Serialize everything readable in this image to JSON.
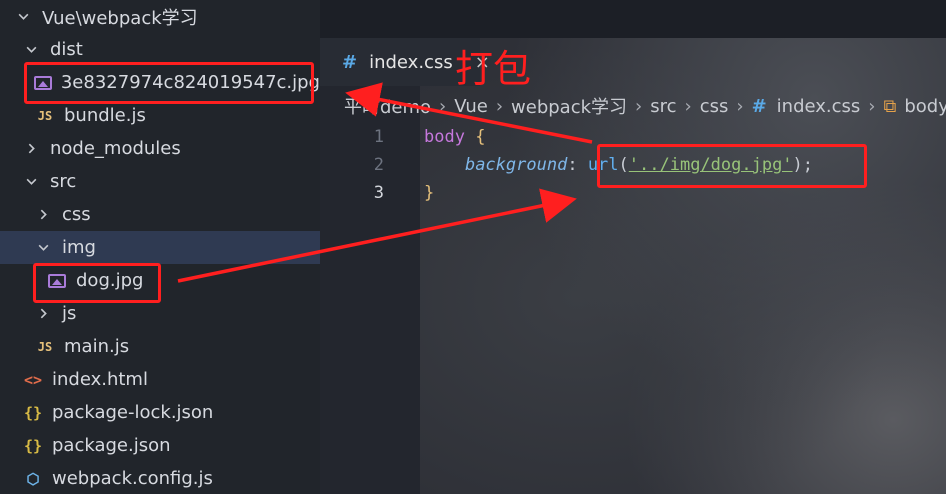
{
  "explorer": {
    "items": [
      {
        "label": "Vue\\webpack学习",
        "type": "folder-open",
        "icon": "chevron-down-icon"
      },
      {
        "label": "dist",
        "type": "folder-open",
        "icon": "chevron-down-icon"
      },
      {
        "label": "3e8327974c824019547c.jpg",
        "type": "image",
        "icon": "image-file-icon"
      },
      {
        "label": "bundle.js",
        "type": "js",
        "icon": "js-file-icon",
        "icon_text": "JS"
      },
      {
        "label": "node_modules",
        "type": "folder-closed",
        "icon": "chevron-right-icon"
      },
      {
        "label": "src",
        "type": "folder-open",
        "icon": "chevron-down-icon"
      },
      {
        "label": "css",
        "type": "folder-closed",
        "icon": "chevron-right-icon"
      },
      {
        "label": "img",
        "type": "folder-open",
        "icon": "chevron-down-icon"
      },
      {
        "label": "dog.jpg",
        "type": "image",
        "icon": "image-file-icon"
      },
      {
        "label": "js",
        "type": "folder-closed",
        "icon": "chevron-right-icon"
      },
      {
        "label": "main.js",
        "type": "js",
        "icon": "js-file-icon",
        "icon_text": "JS"
      },
      {
        "label": "index.html",
        "type": "html",
        "icon": "html-file-icon",
        "icon_text": "<>"
      },
      {
        "label": "package-lock.json",
        "type": "json",
        "icon": "json-file-icon",
        "icon_text": "{}"
      },
      {
        "label": "package.json",
        "type": "json",
        "icon": "json-file-icon",
        "icon_text": "{}"
      },
      {
        "label": "webpack.config.js",
        "type": "config",
        "icon": "webpack-config-icon",
        "icon_text": "⬡"
      }
    ],
    "selected_index": 7
  },
  "editor": {
    "tab": {
      "label": "index.css",
      "icon_text": "#",
      "close_text": "×"
    },
    "breadcrumb": {
      "segments": [
        "平时demo",
        "Vue",
        "webpack学习",
        "src",
        "css",
        "index.css",
        "body"
      ],
      "hash_text": "#"
    },
    "code": [
      {
        "num": "1",
        "selector": "body",
        "open": "{"
      },
      {
        "num": "2",
        "property": "background",
        "colon": ":",
        "fn": "url",
        "paren_open": "(",
        "string": "'../img/dog.jpg'",
        "paren_close": ")",
        "semi": ";"
      },
      {
        "num": "3",
        "close": "}"
      }
    ]
  },
  "annotations": {
    "label": "打包",
    "color": "#ff1f1f"
  },
  "colors": {
    "sidebar_bg": "#21252b",
    "selected_row": "#2f3a52",
    "annotation_red": "#ff1f1f"
  }
}
